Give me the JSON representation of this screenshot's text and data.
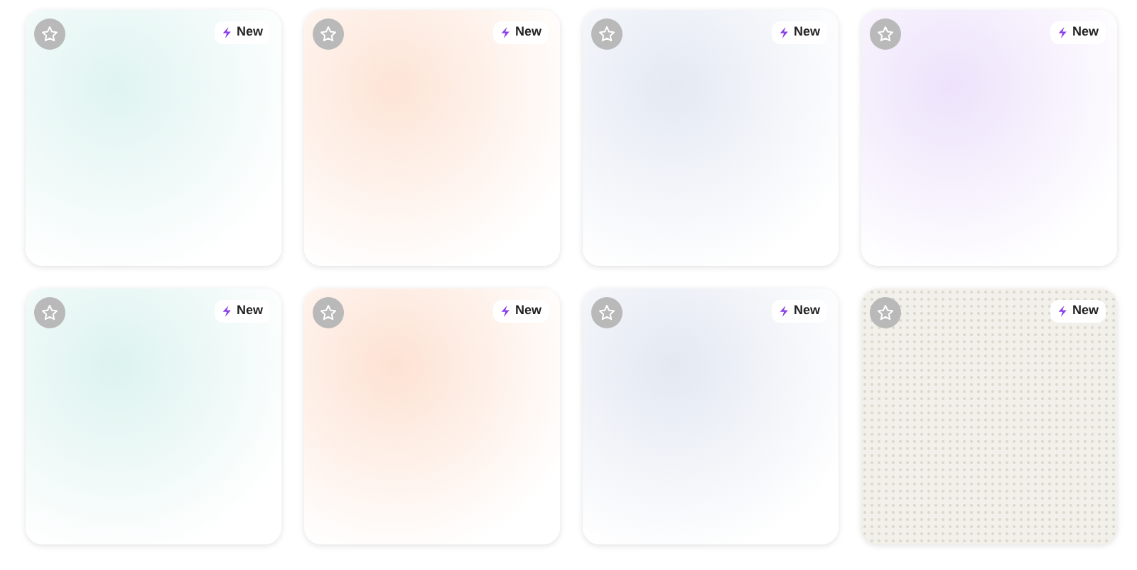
{
  "cards": [
    {
      "kind": "gradient",
      "color": "#dff4f1",
      "starred": false,
      "badge": "New"
    },
    {
      "kind": "gradient",
      "color": "#fde4d6",
      "starred": false,
      "badge": "New"
    },
    {
      "kind": "gradient",
      "color": "#e4e9f3",
      "starred": false,
      "badge": "New"
    },
    {
      "kind": "gradient",
      "color": "#ede2fb",
      "starred": false,
      "badge": "New"
    },
    {
      "kind": "gradient",
      "color": "#dcf3ef",
      "starred": false,
      "badge": "New"
    },
    {
      "kind": "gradient",
      "color": "#fde2d3",
      "starred": false,
      "badge": "New"
    },
    {
      "kind": "gradient",
      "color": "#e3e8f2",
      "starred": false,
      "badge": "New"
    },
    {
      "kind": "pattern",
      "color": "#f2f0ea",
      "starred": false,
      "badge": "New"
    }
  ]
}
